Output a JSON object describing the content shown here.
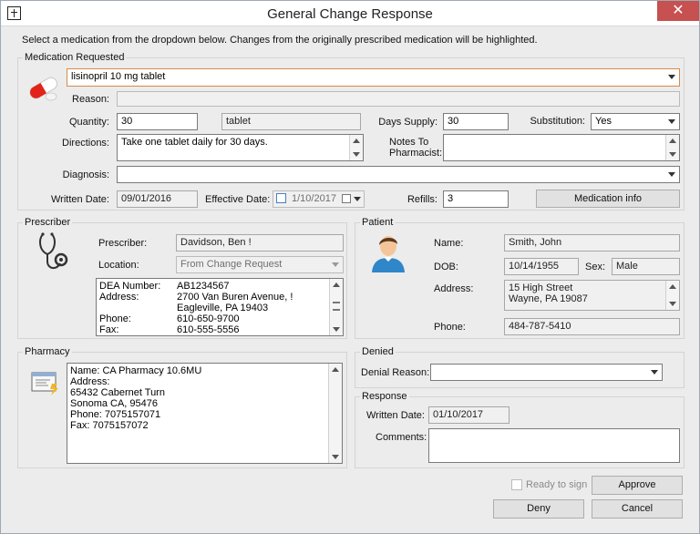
{
  "window": {
    "title": "General Change Response",
    "close": "✕"
  },
  "instruction": "Select a medication from the dropdown below. Changes from the originally prescribed medication will be highlighted.",
  "med": {
    "legend": "Medication Requested",
    "medication": "lisinopril 10 mg tablet",
    "reason_label": "Reason:",
    "reason": "",
    "quantity_label": "Quantity:",
    "quantity": "30",
    "unit": "tablet",
    "days_supply_label": "Days Supply:",
    "days_supply": "30",
    "substitution_label": "Substitution:",
    "substitution": "Yes",
    "directions_label": "Directions:",
    "directions": "Take one tablet daily for 30 days.",
    "notes_label_1": "Notes To",
    "notes_label_2": "Pharmacist:",
    "notes": "",
    "diagnosis_label": "Diagnosis:",
    "diagnosis": "",
    "written_date_label": "Written Date:",
    "written_date": "09/01/2016",
    "effective_date_label": "Effective Date:",
    "effective_date": "1/10/2017",
    "refills_label": "Refills:",
    "refills": "3",
    "med_info_button": "Medication info"
  },
  "prescriber": {
    "legend": "Prescriber",
    "prescriber_label": "Prescriber:",
    "name": "Davidson, Ben !",
    "location_label": "Location:",
    "location": "From Change Request",
    "details": [
      [
        "DEA Number:",
        "AB1234567"
      ],
      [
        "Address:",
        "2700 Van Buren Avenue, !"
      ],
      [
        "",
        "Eagleville, PA 19403"
      ],
      [
        "Phone:",
        "610-650-9700"
      ],
      [
        "Fax:",
        "610-555-5556"
      ]
    ]
  },
  "patient": {
    "legend": "Patient",
    "name_label": "Name:",
    "name": "Smith, John",
    "dob_label": "DOB:",
    "dob": "10/14/1955",
    "sex_label": "Sex:",
    "sex": "Male",
    "address_label": "Address:",
    "address_1": "15 High Street",
    "address_2": "Wayne, PA 19087",
    "phone_label": "Phone:",
    "phone": "484-787-5410"
  },
  "pharmacy": {
    "legend": "Pharmacy",
    "lines": [
      "Name: CA Pharmacy 10.6MU",
      "Address:",
      "65432 Cabernet Turn",
      "Sonoma CA, 95476",
      "Phone: 7075157071",
      "Fax: 7075157072"
    ]
  },
  "denied": {
    "legend": "Denied",
    "reason_label": "Denial Reason:",
    "reason": ""
  },
  "response": {
    "legend": "Response",
    "written_date_label": "Written Date:",
    "written_date": "01/10/2017",
    "comments_label": "Comments:",
    "comments": ""
  },
  "footer": {
    "ready_label": "Ready to sign",
    "approve": "Approve",
    "deny": "Deny",
    "cancel": "Cancel"
  }
}
